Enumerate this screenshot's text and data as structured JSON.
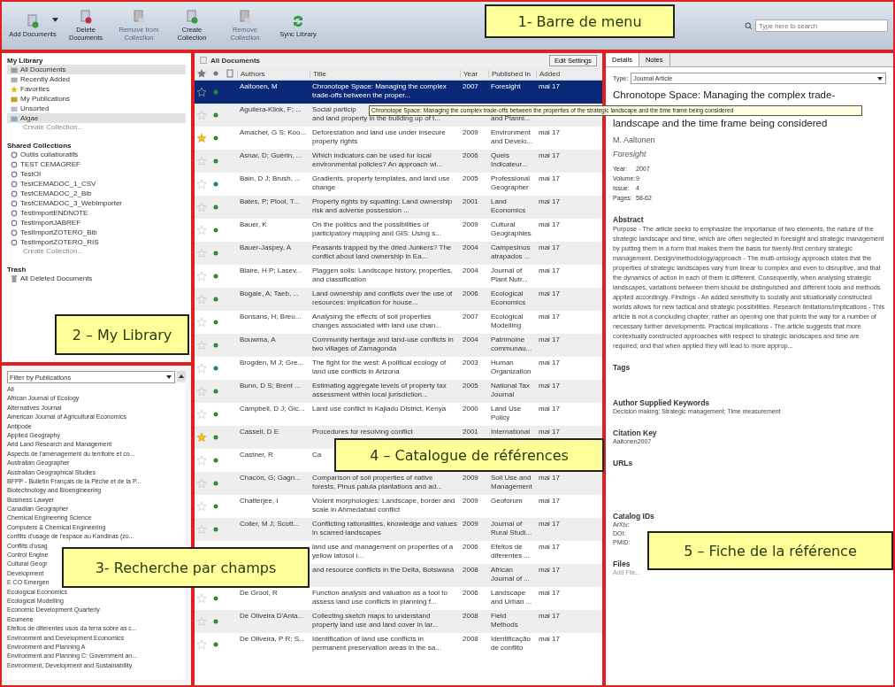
{
  "toolbar": {
    "buttons": [
      {
        "label": "Add Documents",
        "kind": "add",
        "disabled": false,
        "has_menu": true
      },
      {
        "label": "Delete Documents",
        "kind": "delete",
        "disabled": false,
        "has_menu": false
      },
      {
        "label": "Remove from Collection",
        "kind": "remove",
        "disabled": true,
        "has_menu": false
      },
      {
        "label": "Create Collection",
        "kind": "create",
        "disabled": false,
        "has_menu": false
      },
      {
        "label": "Remove Collection",
        "kind": "remove",
        "disabled": true,
        "has_menu": false
      },
      {
        "label": "Sync Library",
        "kind": "sync",
        "disabled": false,
        "has_menu": false
      }
    ],
    "search": {
      "placeholder": "Type here to search"
    }
  },
  "library": {
    "heading": "My Library",
    "items": [
      {
        "label": "All Documents",
        "kind": "all",
        "selected": true
      },
      {
        "label": "Recently Added",
        "kind": "recent",
        "selected": false
      },
      {
        "label": "Favorites",
        "kind": "favorites",
        "selected": false
      },
      {
        "label": "My Publications",
        "kind": "publications",
        "selected": false
      },
      {
        "label": "Unsorted",
        "kind": "unsorted",
        "selected": false
      },
      {
        "label": "Algae",
        "kind": "folder",
        "selected": true
      }
    ],
    "create": "Create Collection...",
    "shared_heading": "Shared Collections",
    "shared": [
      "Outils collaboratifs",
      "TEST CEMAGREF",
      "TestOI",
      "TestCEMADOC_1_CSV",
      "TestCEMADOC_2_Bib",
      "TestCEMADOC_3_WebImporter",
      "TestImportENDNOTE",
      "TestImportJABREF",
      "TestImportZOTERO_Bib",
      "TestImportZOTERO_RIS"
    ],
    "shared_create": "Create Collection...",
    "trash_heading": "Trash",
    "trash": [
      "All Deleted Documents"
    ]
  },
  "filter": {
    "value": "Filter by Publications",
    "items": [
      "All",
      "African Journal of Ecology",
      "Alternatives Journal",
      "American Journal of Agricultural Economics",
      "Antipode",
      "Applied Geography",
      "Arid Land Research and Management",
      "Aspects de l'aménagement du territoire et co...",
      "Australian Geographer",
      "Australian Geographical Studies",
      "BFPP - Bulletin Français de la Pêche et de la P...",
      "Biotechnology and Bioengineering",
      "Business Lawyer",
      "Canadian Geographer",
      "Chemical Engineering Science",
      "Computers & Chemical Engineering",
      "conflits d'usage de l'espace au Kandinas (zo...",
      "Conflits d'usag",
      "Control Engine",
      "Cultural Geogr",
      "Development",
      "E CO Emergen",
      "Ecological Economics",
      "Ecological Modelling",
      "Economic Development Quarterly",
      "Ecumene",
      "Efeitos de diferentes usos da terra sobre as c...",
      "Environment and Development Economics",
      "Environment and Planning A",
      "Environment and Planning C: Government an...",
      "Environment, Development and Sustainability"
    ]
  },
  "documents": {
    "title": "All Documents",
    "edit_button": "Edit Settings",
    "columns": [
      "Authors",
      "Title",
      "Year",
      "Published In",
      "Added"
    ],
    "rows": [
      {
        "authors": "Aaltonen, M",
        "title": "Chronotope Space: Managing the complex trade-offs between the proper...",
        "year": "2007",
        "published": "Foresight",
        "added": "mai 17",
        "favorite": false,
        "unread": true,
        "selected": true
      },
      {
        "authors": "Aguilera-Klink, F; ...",
        "title": "Social particip",
        "title_below": "and land property in the building up of t...",
        "year": "",
        "published": "and Planni...",
        "added": "",
        "favorite": false,
        "unread": true,
        "selected": false
      },
      {
        "authors": "Amacher, G S; Koo...",
        "title": "Deforestation and land use under insecure property rights",
        "year": "2009",
        "published": "Environment and Develo...",
        "added": "mai 17",
        "favorite": true,
        "unread": true,
        "selected": false
      },
      {
        "authors": "Asnar, D; Guérin, ...",
        "title": "Which indicators can be used for local environmental policies? An approach wi...",
        "year": "2006",
        "published": "Quels Indicateur...",
        "added": "mai 17",
        "favorite": false,
        "unread": true,
        "selected": false
      },
      {
        "authors": "Bain, D J; Brush, ...",
        "title": "Gradients, property templates, and land use change",
        "year": "2005",
        "published": "Professional Geographer",
        "added": "mai 17",
        "favorite": false,
        "unread": true,
        "selected": false
      },
      {
        "authors": "Bates, P; Plool, T...",
        "title": "Property rights by squatting: Land ownership risk and adverse possession ...",
        "year": "2001",
        "published": "Land Economics",
        "added": "mai 17",
        "favorite": false,
        "unread": true,
        "selected": false
      },
      {
        "authors": "Bauer, K",
        "title": "On the politics and the possibilities of participatory mapping and GIS: Using s...",
        "year": "2009",
        "published": "Cultural Geographies",
        "added": "mai 17",
        "favorite": false,
        "unread": true,
        "selected": false
      },
      {
        "authors": "Bauer-Jaspey, A",
        "title": "Peasants trapped by the dried Junkers? The conflict about land ownership in Ea...",
        "year": "2004",
        "published": "Campesinos atrapados ...",
        "added": "mai 17",
        "favorite": false,
        "unread": true,
        "selected": false
      },
      {
        "authors": "Blaire, H P; Lasev...",
        "title": "Plaggen soils: Landscape history, properties, and classification",
        "year": "2004",
        "published": "Journal of Plant Nutr...",
        "added": "mai 17",
        "favorite": false,
        "unread": true,
        "selected": false
      },
      {
        "authors": "Bogale, A; Taeb, ...",
        "title": "Land ownership and conflicts over the use of resources: implication for house...",
        "year": "2006",
        "published": "Ecological Economics",
        "added": "mai 17",
        "favorite": false,
        "unread": true,
        "selected": false
      },
      {
        "authors": "Bonsans, H; Breu...",
        "title": "Analysing the effects of soil properties changes associated with land use chan...",
        "year": "2007",
        "published": "Ecological Modelling",
        "added": "mai 17",
        "favorite": false,
        "unread": true,
        "selected": false
      },
      {
        "authors": "Bouwma, A",
        "title": "Community heritage and land-use conflicts in two villages of Zamagonda",
        "year": "2004",
        "published": "Patrimoine communau...",
        "added": "mai 17",
        "favorite": false,
        "unread": true,
        "selected": false
      },
      {
        "authors": "Brogden, M J; Gre...",
        "title": "The fight for the west: A political ecology of land use conflicts in Arizona",
        "year": "2003",
        "published": "Human Organization",
        "added": "mai 17",
        "favorite": false,
        "unread": true,
        "selected": false
      },
      {
        "authors": "Bunn, D S; Brent ...",
        "title": "Estimating aggregate levels of property tax assessment within local jurisdiction...",
        "year": "2005",
        "published": "National Tax Journal",
        "added": "mai 17",
        "favorite": false,
        "unread": true,
        "selected": false
      },
      {
        "authors": "Campbell, D J; Gic...",
        "title": "Land use conflict in Kajiado District, Kenya",
        "year": "2000",
        "published": "Land Use Policy",
        "added": "mai 17",
        "favorite": false,
        "unread": true,
        "selected": false
      },
      {
        "authors": "Cassell, D E",
        "title": "Procedures for resolving conflict",
        "year": "2001",
        "published": "International",
        "added": "mai 17",
        "favorite": true,
        "unread": true,
        "selected": false
      },
      {
        "authors": "Castner, R",
        "title": "Ca",
        "year": "",
        "published": "",
        "added": "",
        "favorite": false,
        "unread": true,
        "selected": false
      },
      {
        "authors": "Chacón, G; Gagn...",
        "title": "Comparison of soil properties of native forests, Pinus patula plantations and ad...",
        "year": "2009",
        "published": "Soil Use and Management",
        "added": "mai 17",
        "favorite": false,
        "unread": true,
        "selected": false
      },
      {
        "authors": "Chatterjee, I",
        "title": "Violent morphologies: Landscape, border and scale in Ahmedabad conflict",
        "year": "2009",
        "published": "Geoforum",
        "added": "mai 17",
        "favorite": false,
        "unread": true,
        "selected": false
      },
      {
        "authors": "Coller, M J; Scott...",
        "title": "Conflicting rationalities, knowledge and values in scarred landscapes",
        "year": "2009",
        "published": "Journal of Rural Studi...",
        "added": "mai 17",
        "favorite": false,
        "unread": true,
        "selected": false
      },
      {
        "authors": "",
        "title": "land use and management on properties of a yellow latosol i...",
        "year": "2006",
        "published": "Efeitos de diferentes ...",
        "added": "mai 17",
        "selected": false
      },
      {
        "authors": "",
        "title": "and resource conflicts in the Delta, Botswana",
        "year": "2008",
        "published": "African Journal of ...",
        "added": "mai 17",
        "selected": false
      },
      {
        "authors": "De Groot, R",
        "title": "Function analysis and valuation as a tool to assess land use conflicts in planning f...",
        "year": "2006",
        "published": "Landscape and Urban ...",
        "added": "mai 17",
        "favorite": false,
        "unread": true,
        "selected": false
      },
      {
        "authors": "De Oliveira D'Anta...",
        "title": "Collecting sketch maps to understand property land use and land cover in lar...",
        "year": "2008",
        "published": "Field Methods",
        "added": "mai 17",
        "favorite": false,
        "unread": true,
        "selected": false
      },
      {
        "authors": "De Oliveira, P R; S...",
        "title": "Identification of land use conflicts in permanent preservation areas in the sa...",
        "year": "2008",
        "published": "Identificação de conflito",
        "added": "mai 17",
        "favorite": false,
        "unread": true,
        "selected": false
      }
    ]
  },
  "tooltip": "Chronotope Space: Managing the complex trade-offs between the properties of the strategic landscape and the time frame being considered",
  "details": {
    "tabs": [
      {
        "label": "Details",
        "selected": true
      },
      {
        "label": "Notes",
        "selected": false
      }
    ],
    "type_label": "Type:",
    "type_value": "Journal Article",
    "title": [
      "Chronotope Space: Managing the complex trade-",
      "landscape and the time frame being considered"
    ],
    "author": "M. Aaltonen",
    "journal": "Foresight",
    "fields": [
      {
        "label": "Year:",
        "value": "2007"
      },
      {
        "label": "Volume:",
        "value": "9"
      },
      {
        "label": "Issue:",
        "value": "4"
      },
      {
        "label": "Pages:",
        "value": "58-62"
      }
    ],
    "abstract_heading": "Abstract",
    "abstract": "Purpose - The article seeks to emphasize the importance of two elements, the nature of the strategic landscape and time, which are often neglected in foresight and strategic management by putting them in a form that makes them the basis for twenty-first century strategic management. Design/methodology/approach - The multi-ontology approach states that the properties of strategic landscapes vary from linear to complex and even to disruptive, and that the dynamics of action in each of them is different. Consequently, when analysing strategic landscapes, variations between them should be distinguished and different tools and methods applied accordingly. Findings - An added sensitivity to socially and situationally constructed worlds allows for new tactical and strategic possibilities. Research limitations/implications - This article is not a concluding chapter, rather an opening one that points the way for a number of necessary further developments. Practical implications - The article suggests that more contextually constructed approaches with respect to strategic landscapes and time are required; and that when applied they will lead to more approp...",
    "tags_heading": "Tags",
    "keywords_heading": "Author Supplied Keywords",
    "keywords": "Decision making; Strategic management; Time measurement",
    "citation_heading": "Citation Key",
    "citation": "Aaltonen2007",
    "urls_heading": "URLs",
    "catalog_heading": "Catalog IDs",
    "catalog": [
      "ArXiv:",
      "DOI:",
      "PMID:"
    ],
    "files_heading": "Files",
    "files_add": "Add File..."
  },
  "annotations": [
    "1- Barre de menu",
    "2 – My Library",
    "3- Recherche par champs",
    "4 – Catalogue de références",
    "5 – Fiche de la référence"
  ]
}
